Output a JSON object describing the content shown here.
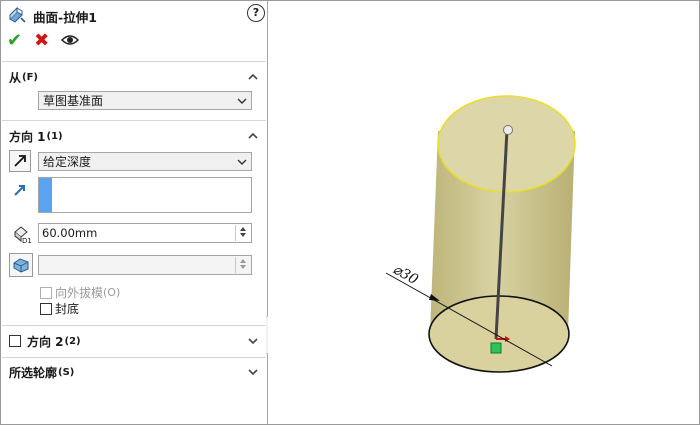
{
  "feature": {
    "title": "曲面-拉伸1",
    "help_symbol": "?"
  },
  "from": {
    "label": "从",
    "sub": "(F)",
    "start_condition": "草图基准面"
  },
  "direction1": {
    "label": "方向 1",
    "sub": "(1)",
    "end_condition": "给定深度",
    "depth_value": "60.00mm",
    "draft_outward_label": "向外拔模",
    "draft_outward_sub": "(O)",
    "cap_end_label": "封底"
  },
  "direction2": {
    "label": "方向 2",
    "sub": "(2)"
  },
  "selected_contours": {
    "label": "所选轮廓",
    "sub": "(S)"
  },
  "dimension": {
    "text": "⌀30"
  },
  "colors": {
    "confirm": "#28a428",
    "cancel": "#d01515",
    "selection_blue": "#5aa3f0",
    "cylinder_fill": "#cfc894",
    "cylinder_edge": "#e8df2a"
  },
  "icons": [
    "feature-surface-extrude-icon",
    "help-icon",
    "confirm-check-icon",
    "cancel-x-icon",
    "preview-eye-icon",
    "reverse-direction-icon",
    "direction-vector-icon",
    "depth-icon",
    "draft-icon",
    "chevron-up-icon",
    "chevron-down-icon"
  ]
}
